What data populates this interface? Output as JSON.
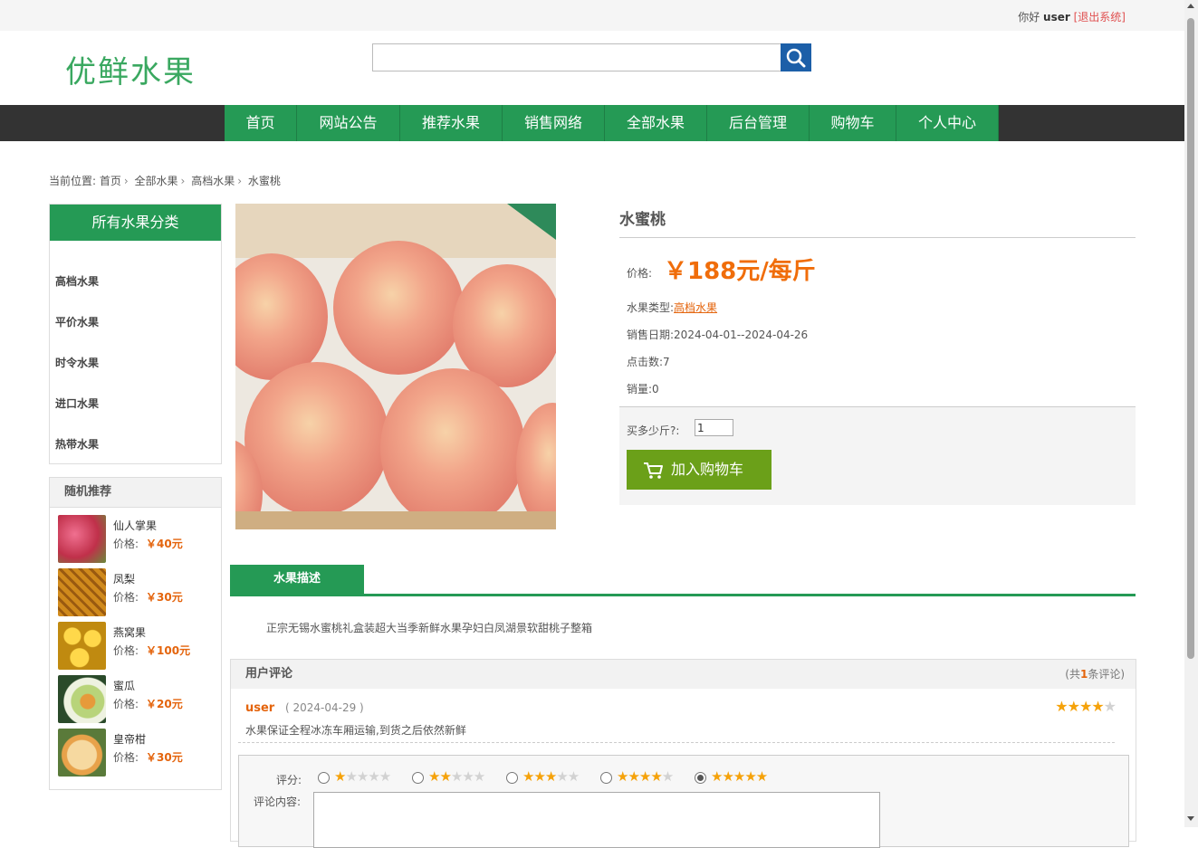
{
  "header": {
    "greeting": "你好",
    "username": "user",
    "logout": "[退出系统]",
    "logo": "优鲜水果",
    "search_value": ""
  },
  "nav": [
    "首页",
    "网站公告",
    "推荐水果",
    "销售网络",
    "全部水果",
    "后台管理",
    "购物车",
    "个人中心"
  ],
  "breadcrumb": [
    "当前位置:",
    "首页",
    "全部水果",
    "高档水果",
    "水蜜桃"
  ],
  "sidebar": {
    "category_title": "所有水果分类",
    "categories": [
      "高档水果",
      "平价水果",
      "时令水果",
      "进口水果",
      "热带水果"
    ],
    "recommend_title": "随机推荐",
    "price_label": "价格:",
    "recommend": [
      {
        "name": "仙人掌果",
        "price": "￥40元",
        "color": "#c0304a"
      },
      {
        "name": "凤梨",
        "price": "￥30元",
        "color": "#d08a1c"
      },
      {
        "name": "燕窝果",
        "price": "￥100元",
        "color": "#e8b420"
      },
      {
        "name": "蜜瓜",
        "price": "￥20元",
        "color": "#b8d47a"
      },
      {
        "name": "皇帝柑",
        "price": "￥30元",
        "color": "#e8a24a"
      }
    ]
  },
  "product": {
    "name": "水蜜桃",
    "price_label": "价格:",
    "price": "￥188元/每斤",
    "type_label": "水果类型:",
    "type": "高档水果",
    "date_label": "销售日期:",
    "date": "2024-04-01--2024-04-26",
    "clicks_label": "点击数:",
    "clicks": "7",
    "sales_label": "销量:",
    "sales": "0",
    "qty_label": "买多少斤?:",
    "qty": "1",
    "cart_button": "加入购物车"
  },
  "tabs": {
    "desc_tab": "水果描述",
    "description": "正宗无锡水蜜桃礼盒装超大当季新鲜水果孕妇白凤湖景软甜桃子整箱"
  },
  "reviews": {
    "title": "用户评论",
    "count_prefix": "(共",
    "count": "1",
    "count_suffix": "条评论)",
    "items": [
      {
        "user": "user",
        "date": "( 2024-04-29 )",
        "text": "水果保证全程冰冻车厢运输,到货之后依然新鲜",
        "rating": 4
      }
    ],
    "form": {
      "rating_label": "评分:",
      "content_label": "评论内容:",
      "selected_rating": 5
    }
  },
  "colors": {
    "primary": "#259a55",
    "accent": "#f06d0a",
    "cart": "#6ba019"
  }
}
